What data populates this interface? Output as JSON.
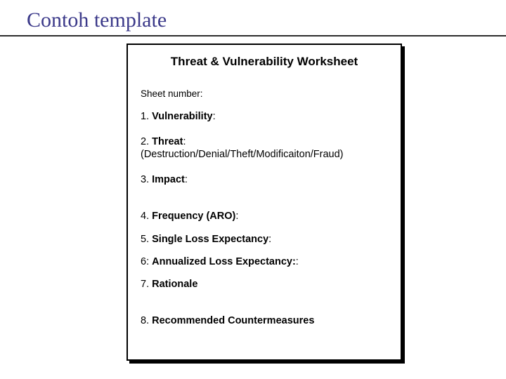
{
  "slide": {
    "title": "Contoh template"
  },
  "worksheet": {
    "title": "Threat & Vulnerability Worksheet",
    "sheet_number_label": "Sheet number:",
    "items": [
      {
        "num": "1.",
        "label": "Vulnerability",
        "suffix": ":"
      },
      {
        "num": "2.",
        "label": "Threat",
        "suffix": ":",
        "note": "(Destruction/Denial/Theft/Modificaiton/Fraud)"
      },
      {
        "num": "3.",
        "label": "Impact",
        "suffix": ":"
      },
      {
        "num": "4.",
        "label": "Frequency (ARO)",
        "suffix": ":"
      },
      {
        "num": "5.",
        "label": "Single Loss Expectancy",
        "suffix": ":"
      },
      {
        "num": "6:",
        "label": "Annualized Loss Expectancy:",
        "suffix": ":"
      },
      {
        "num": "7.",
        "label": "Rationale",
        "suffix": ""
      },
      {
        "num": "8.",
        "label": "Recommended Countermeasures",
        "suffix": ""
      }
    ]
  }
}
